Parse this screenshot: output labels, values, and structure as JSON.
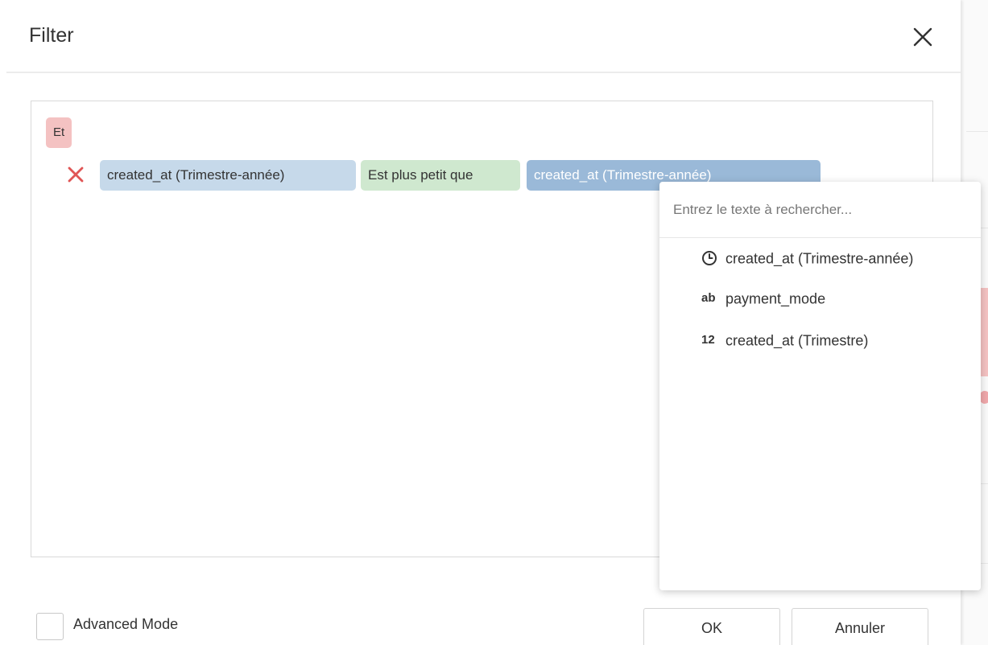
{
  "dialog": {
    "title": "Filter",
    "close_icon": "close-icon"
  },
  "filter": {
    "group_operator": "Et",
    "condition": {
      "remove_icon": "remove-icon",
      "field": "created_at (Trimestre-année)",
      "operator": "Est plus petit que",
      "value": "created_at (Trimestre-année)"
    }
  },
  "dropdown": {
    "search_placeholder": "Entrez le texte à rechercher...",
    "items": [
      {
        "icon": "clock-icon",
        "icon_text": "",
        "label": "created_at (Trimestre-année)"
      },
      {
        "icon": "text-type-icon",
        "icon_text": "ab",
        "label": "payment_mode"
      },
      {
        "icon": "number-type-icon",
        "icon_text": "12",
        "label": "created_at (Trimestre)"
      }
    ]
  },
  "footer": {
    "advanced_mode_label": "Advanced Mode",
    "advanced_mode_checked": false,
    "ok_label": "OK",
    "cancel_label": "Annuler"
  },
  "colors": {
    "group_chip": "#f4c2c2",
    "field_chip": "#c6d9ea",
    "operator_chip": "#cfe8cf",
    "value_chip": "#9ab9d8",
    "remove_icon": "#e05555"
  }
}
